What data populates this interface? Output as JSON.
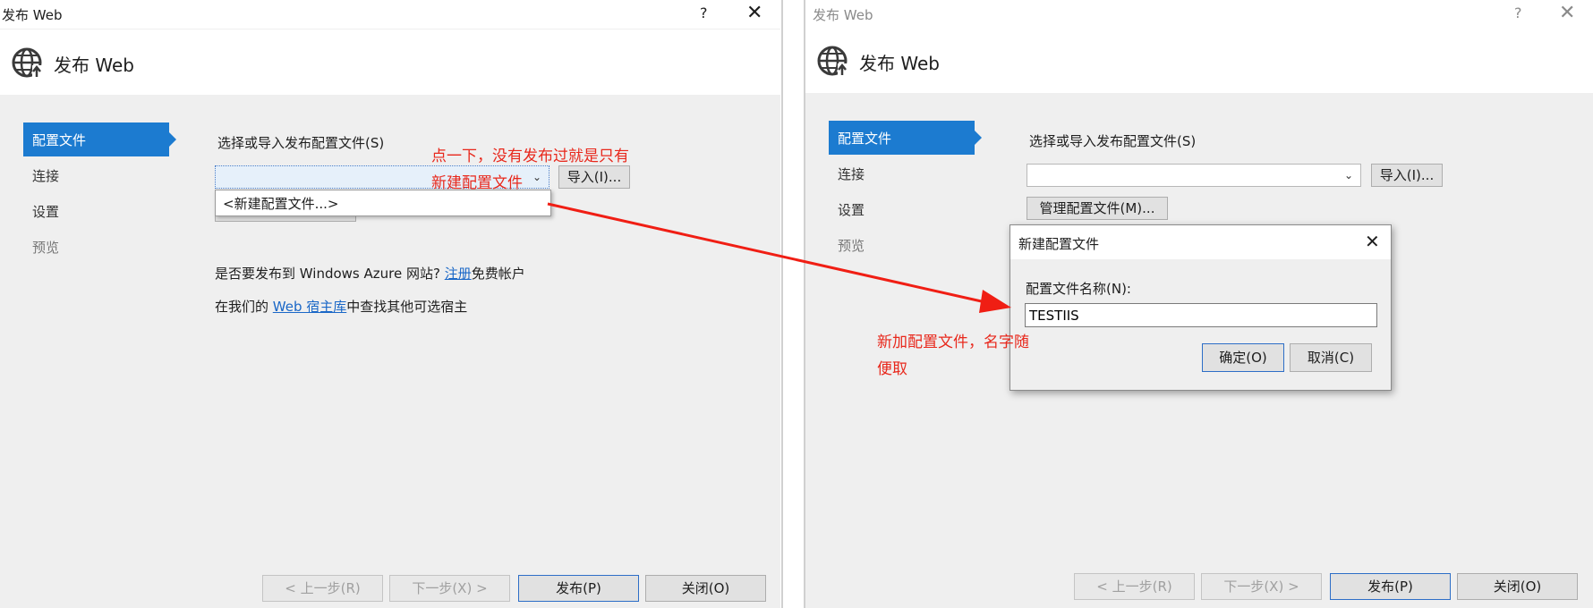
{
  "left": {
    "window_title": "发布 Web",
    "help_label": "?",
    "close_glyph": "✕",
    "header_title": "发布 Web",
    "nav": [
      {
        "label": "配置文件"
      },
      {
        "label": "连接"
      },
      {
        "label": "设置"
      },
      {
        "label": "预览"
      }
    ],
    "profile_label": "选择或导入发布配置文件(S)",
    "import_button": "导入(I)...",
    "dropdown_option": "<新建配置文件...>",
    "azure_prefix": "是否要发布到 Windows Azure 网站? ",
    "azure_link": "注册",
    "azure_suffix": "免费帐户",
    "hoster_prefix": "在我们的 ",
    "hoster_link": "Web 宿主库",
    "hoster_suffix": "中查找其他可选宿主",
    "footer": {
      "prev": "< 上一步(R)",
      "next": "下一步(X) >",
      "publish": "发布(P)",
      "close": "关闭(O)"
    }
  },
  "right": {
    "window_title": "发布 Web",
    "help_label": "?",
    "close_glyph": "✕",
    "header_title": "发布 Web",
    "nav": [
      {
        "label": "配置文件"
      },
      {
        "label": "连接"
      },
      {
        "label": "设置"
      },
      {
        "label": "预览"
      }
    ],
    "profile_label": "选择或导入发布配置文件(S)",
    "import_button": "导入(I)...",
    "manage_button": "管理配置文件(M)...",
    "footer": {
      "prev": "< 上一步(R)",
      "next": "下一步(X) >",
      "publish": "发布(P)",
      "close": "关闭(O)"
    }
  },
  "new_profile_dialog": {
    "title": "新建配置文件",
    "close_glyph": "✕",
    "name_label": "配置文件名称(N):",
    "name_value": "TESTIIS",
    "ok_button": "确定(O)",
    "cancel_button": "取消(C)"
  },
  "annotations": {
    "note1_line1": "点一下，没有发布过就是只有",
    "note1_line2": "新建配置文件",
    "note2_line1": "新加配置文件，名字随",
    "note2_line2": "便取"
  },
  "colors": {
    "accent": "#1c7bd0",
    "annotation": "#e8281c",
    "link": "#1a67c7"
  },
  "icons": [
    "globe-icon",
    "close-icon",
    "chevron-down-icon",
    "arrow-icon"
  ]
}
